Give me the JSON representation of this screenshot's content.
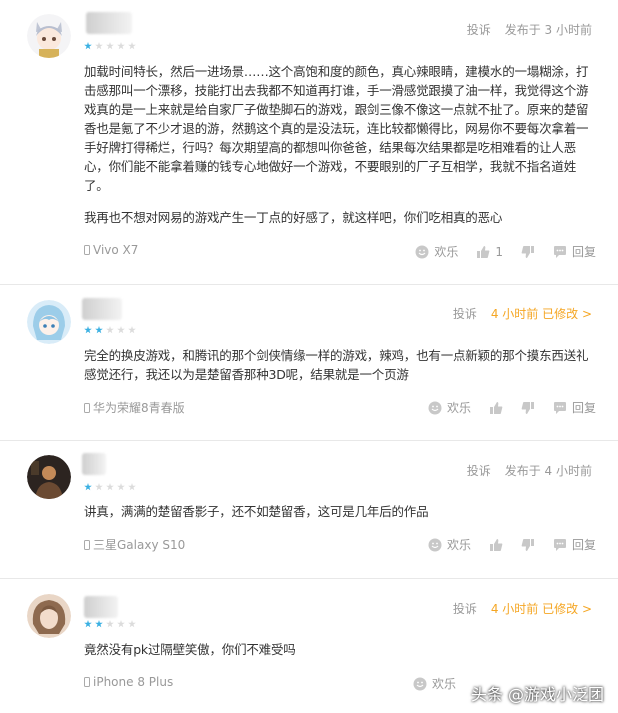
{
  "reviews": [
    {
      "stars": 1,
      "report": "投诉",
      "time": "发布于 3 小时前",
      "paragraphs": [
        "加载时间特长，然后一进场景……这个高饱和度的颜色，真心辣眼睛，建模水的一塌糊涂，打击感那叫一个漂移，技能打出去我都不知道再打谁，手一滑感觉跟摸了油一样，我觉得这个游戏真的是一上来就是给自家厂子做垫脚石的游戏，跟剑三像不像这一点就不扯了。原来的楚留香也是氪了不少才退的游，然鹅这个真的是没法玩，连比较都懒得比，网易你不要每次拿着一手好牌打得稀烂，行吗？每次期望高的都想叫你爸爸，结果每次结果都是吃相难看的让人恶心，你们能不能拿着赚的钱专心地做好一个游戏，不要眼别的厂子互相学，我就不指名道姓了。",
        "我再也不想对网易的游戏产生一丁点的好感了，就这样吧，你们吃相真的恶心"
      ],
      "device": "Vivo X7",
      "happy": "欢乐",
      "likes": "1",
      "reply": "回复"
    },
    {
      "stars": 2,
      "report": "投诉",
      "time": "4 小时前 已修改 >",
      "paragraphs": [
        "完全的换皮游戏，和腾讯的那个剑侠情缘一样的游戏，辣鸡，也有一点新颖的那个摸东西送礼感觉还行，我还以为是楚留香那种3D呢，结果就是一个页游"
      ],
      "device": "华为荣耀8青春版",
      "happy": "欢乐",
      "likes": "",
      "reply": "回复"
    },
    {
      "stars": 1,
      "report": "投诉",
      "time": "发布于 4 小时前",
      "paragraphs": [
        "讲真，满满的楚留香影子，还不如楚留香，这可是几年后的作品"
      ],
      "device": "三星Galaxy S10",
      "happy": "欢乐",
      "likes": "",
      "reply": "回复"
    },
    {
      "stars": 2,
      "report": "投诉",
      "time": "4 小时前 已修改 >",
      "paragraphs": [
        "竟然没有pk过隔壁笑傲，你们不难受吗"
      ],
      "device": "iPhone 8 Plus",
      "happy": "欢乐",
      "likes": "",
      "reply": "回复"
    }
  ],
  "watermark": "头条 @游戏小泛团"
}
